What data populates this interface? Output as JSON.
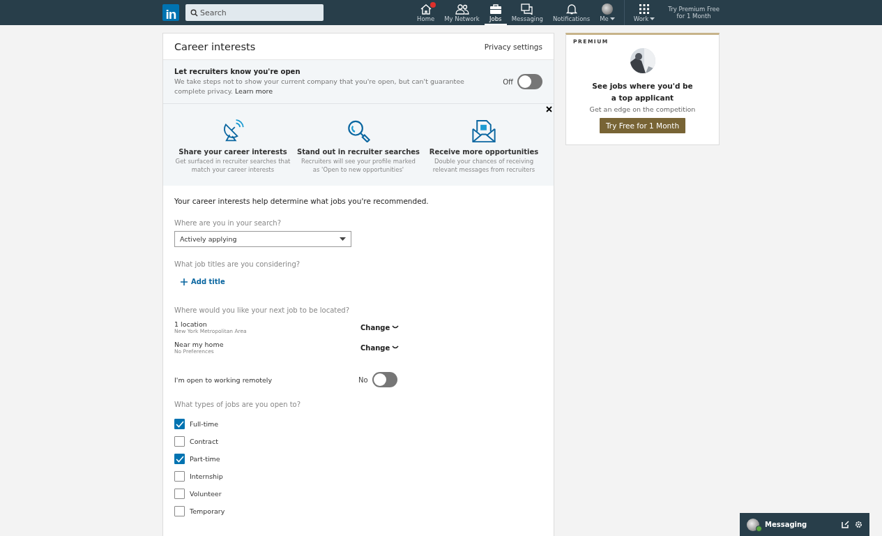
{
  "navbar": {
    "logo": "in",
    "search": {
      "placeholder": "Search"
    },
    "items": [
      {
        "label": "Home",
        "badge": true,
        "selected": false,
        "caret": false
      },
      {
        "label": "My Network",
        "badge": false,
        "selected": false,
        "caret": false
      },
      {
        "label": "Jobs",
        "badge": false,
        "selected": true,
        "caret": false
      },
      {
        "label": "Messaging",
        "badge": false,
        "selected": false,
        "caret": false
      },
      {
        "label": "Notifications",
        "badge": false,
        "selected": false,
        "caret": false
      },
      {
        "label": "Me",
        "badge": false,
        "selected": false,
        "caret": true
      }
    ],
    "work": {
      "label": "Work"
    },
    "premium_link": [
      "Try Premium Free",
      "for 1 Month"
    ]
  },
  "card": {
    "title": "Career interests",
    "privacy_link": "Privacy settings",
    "open_to_recruiters": {
      "title": "Let recruiters know you're open",
      "text": "We take steps not to show your current company that you're open, but can't guarantee complete privacy.",
      "link": "Learn more",
      "toggle_label": "Off",
      "on": false
    },
    "benefits": [
      {
        "title": "Share your career interests",
        "text": "Get surfaced in recruiter searches that match your career interests"
      },
      {
        "title": "Stand out in recruiter searches",
        "text": "Recruiters will see your profile marked as 'Open to new opportunities'"
      },
      {
        "title": "Receive more opportunities",
        "text": "Double your chances of receiving relevant messages from recruiters"
      }
    ],
    "intro": "Your career interests help determine what jobs you're recommended.",
    "search_stage": {
      "label": "Where are you in your search?",
      "value": "Actively applying"
    },
    "job_titles": {
      "label": "What job titles are you considering?",
      "add": "Add title"
    },
    "locations": {
      "label": "Where would you like your next job to be located?",
      "rows": [
        {
          "title": "1 location",
          "sub": "New York Metropolitan Area",
          "action": "Change"
        },
        {
          "title": "Near my home",
          "sub": "No Preferences",
          "action": "Change"
        }
      ]
    },
    "remote": {
      "label": "I'm open to working remotely",
      "toggle_label": "No",
      "on": false
    },
    "job_types": {
      "label": "What types of jobs are you open to?",
      "options": [
        {
          "label": "Full-time",
          "checked": true
        },
        {
          "label": "Contract",
          "checked": false
        },
        {
          "label": "Part-time",
          "checked": true
        },
        {
          "label": "Internship",
          "checked": false
        },
        {
          "label": "Volunteer",
          "checked": false
        },
        {
          "label": "Temporary",
          "checked": false
        }
      ]
    }
  },
  "premium_ad": {
    "tag": "PREMIUM",
    "headline": "See jobs where you'd be a top applicant",
    "text": "Get an edge on the competition",
    "button": "Try Free for 1 Month"
  },
  "messaging_bar": {
    "label": "Messaging",
    "online": true
  }
}
